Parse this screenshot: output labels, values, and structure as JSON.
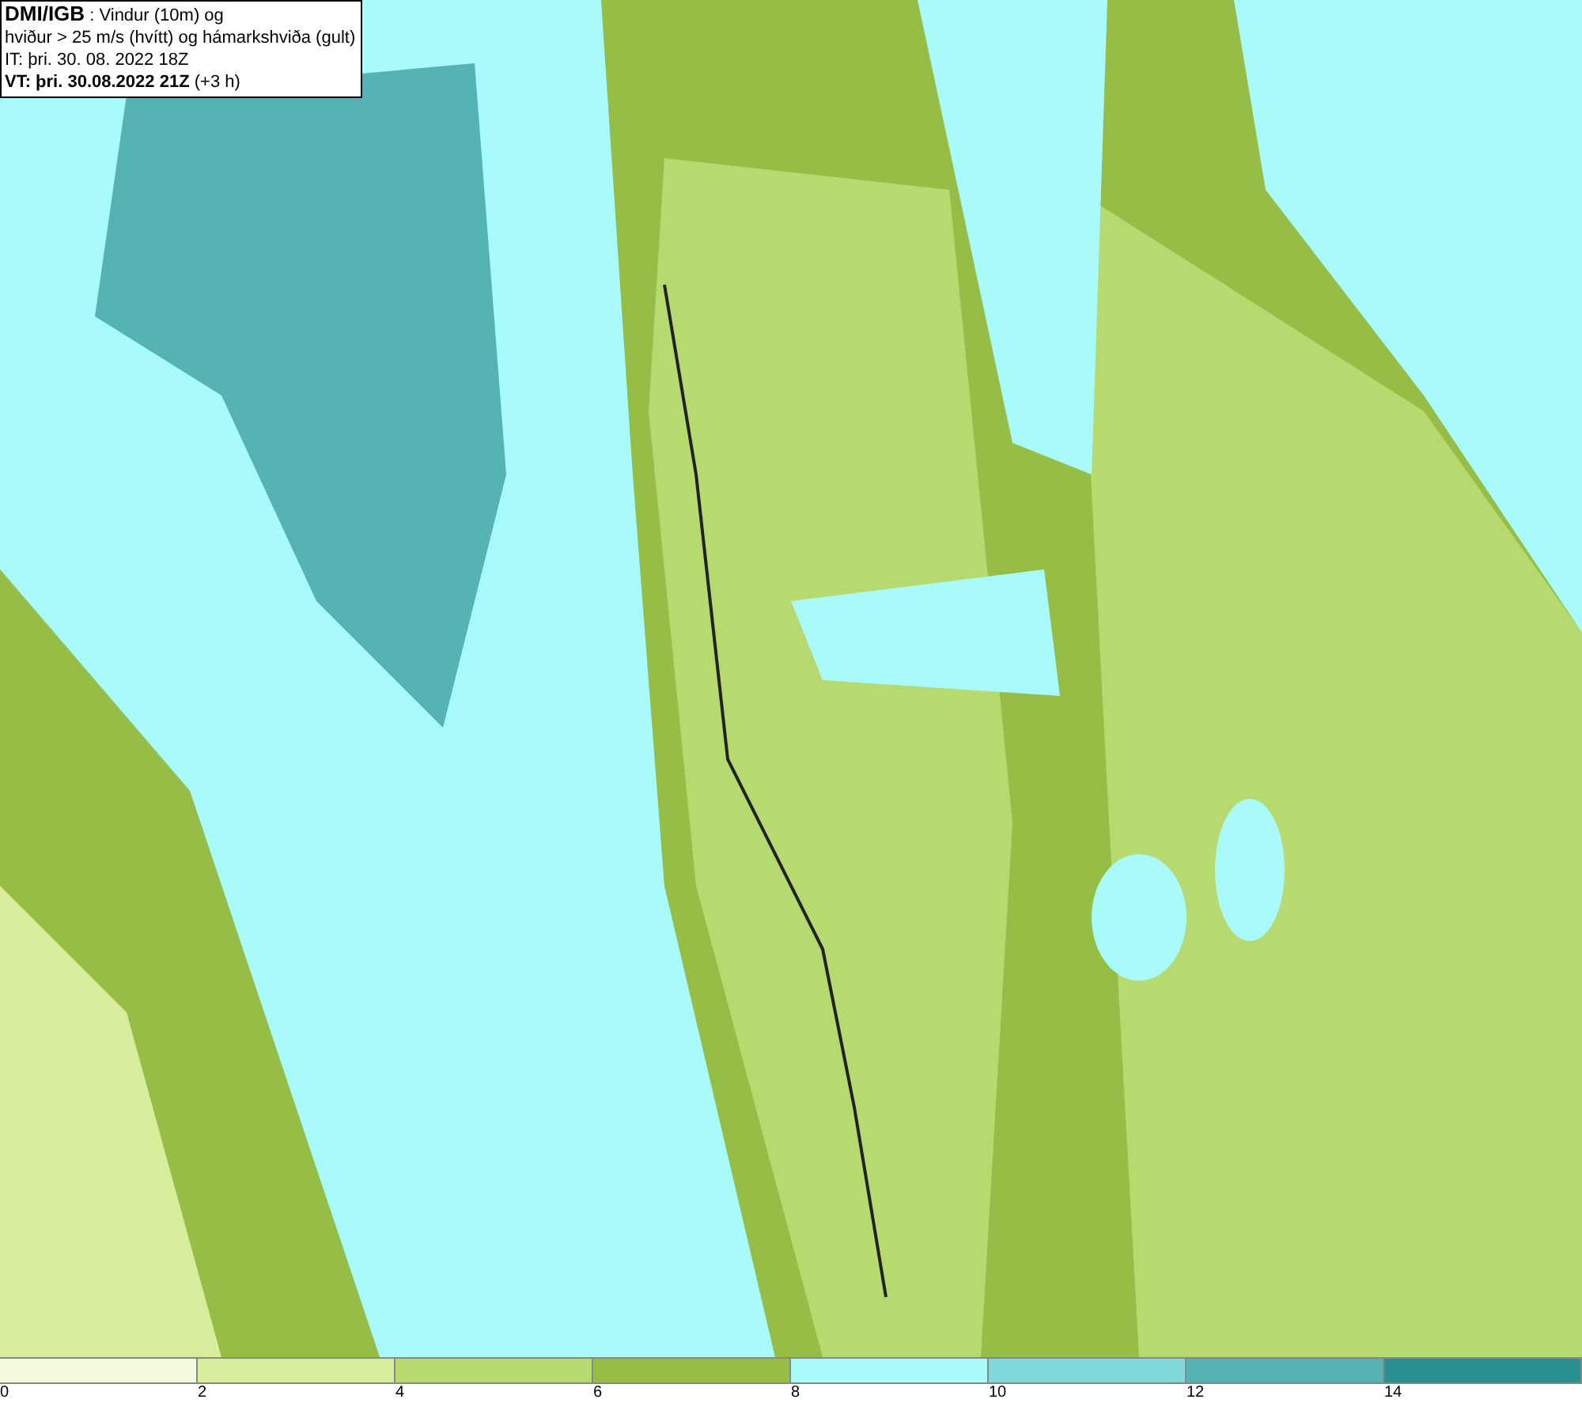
{
  "legend": {
    "lines": [
      "**DMI/IGB** : Vindur (10m) og",
      "hviður > 25 m/s (hvítt) og hámarkshviða (gult)",
      "IT: þri. 30. 08. 2022 18Z",
      "**VT: þri. 30.08.2022 21Z** (+3 h)"
    ]
  },
  "colorbar": {
    "bins": [
      {
        "color": "#f4f9dc"
      },
      {
        "color": "#d8ed9c"
      },
      {
        "color": "#b7da70"
      },
      {
        "color": "#96be47"
      },
      {
        "color": "#a9fbfb"
      },
      {
        "color": "#80d8d8"
      },
      {
        "color": "#55b3b3"
      },
      {
        "color": "#2a8f8f"
      }
    ],
    "ticks": [
      "0",
      "2",
      "4",
      "6",
      "8",
      "10",
      "12",
      "14"
    ]
  }
}
